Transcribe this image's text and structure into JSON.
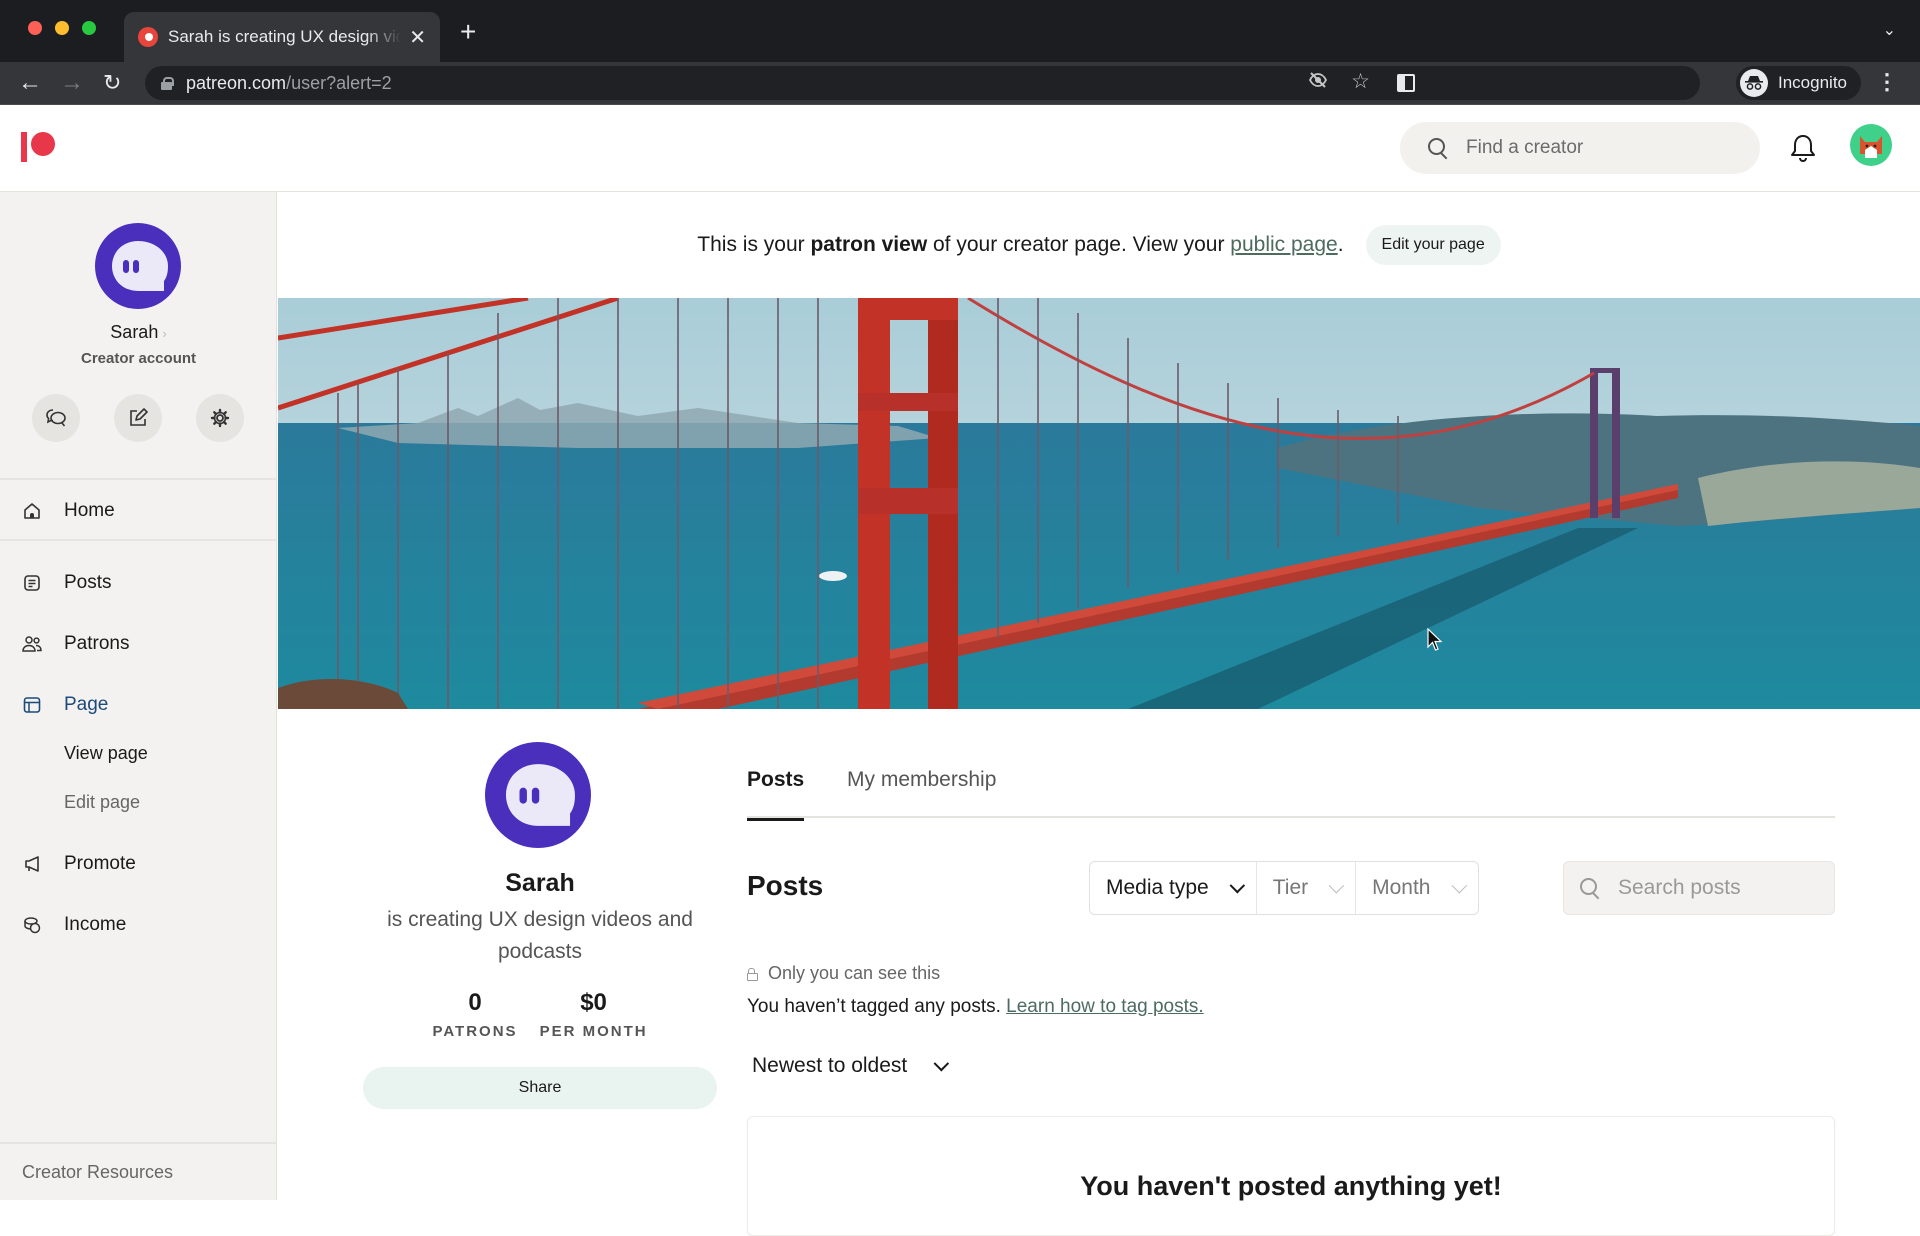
{
  "browser": {
    "tab_title": "Sarah is creating UX design videos and podcasts | Patreon",
    "tab_close": "✕",
    "new_tab": "+",
    "url_host": "patreon.com",
    "url_path": "/user?alert=2",
    "profile_label": "Incognito",
    "icons": {
      "back": "←",
      "forward": "→",
      "reload": "↻",
      "tracking": "◎",
      "star": "☆",
      "menu": "⋮",
      "tab_search": "⌄",
      "incognito": "🕶"
    }
  },
  "header": {
    "search_placeholder": "Find a creator"
  },
  "sidebar": {
    "user_name": "Sarah",
    "user_chevron": "›",
    "account_type": "Creator account",
    "nav": [
      {
        "label": "Home",
        "icon": "home-icon"
      },
      {
        "label": "Posts",
        "icon": "posts-icon"
      },
      {
        "label": "Patrons",
        "icon": "patrons-icon"
      },
      {
        "label": "Page",
        "icon": "page-icon",
        "active": true
      },
      {
        "label": "Promote",
        "icon": "megaphone-icon"
      },
      {
        "label": "Income",
        "icon": "coins-icon"
      }
    ],
    "page_sub": [
      "View page",
      "Edit page"
    ],
    "footer_link": "Creator Resources"
  },
  "notice": {
    "prefix": "This is your ",
    "bold": "patron view",
    "middle": " of your creator page. View your ",
    "link": "public page",
    "suffix": ".",
    "edit_button": "Edit your page"
  },
  "profile": {
    "name": "Sarah",
    "tagline": "is creating UX design videos and podcasts",
    "stats": [
      {
        "value": "0",
        "label": "PATRONS"
      },
      {
        "value": "$0",
        "label": "PER MONTH"
      }
    ],
    "share_label": "Share"
  },
  "content": {
    "tabs": [
      {
        "label": "Posts",
        "active": true
      },
      {
        "label": "My membership",
        "active": false
      }
    ],
    "heading": "Posts",
    "filters": [
      {
        "label": "Media type",
        "muted": false
      },
      {
        "label": "Tier",
        "muted": true
      },
      {
        "label": "Month",
        "muted": true
      }
    ],
    "search_placeholder": "Search posts",
    "private_note": "Only you can see this",
    "tag_note": "You haven’t tagged any posts. ",
    "tag_link": "Learn how to tag posts.",
    "sort_label": "Newest to oldest",
    "empty_message": "You haven't posted anything yet!"
  },
  "colors": {
    "brand": "#e8364a",
    "avatar_purple": "#4a2fbd",
    "active_nav": "#1c4a7a",
    "link_green": "#4d6b5f"
  }
}
